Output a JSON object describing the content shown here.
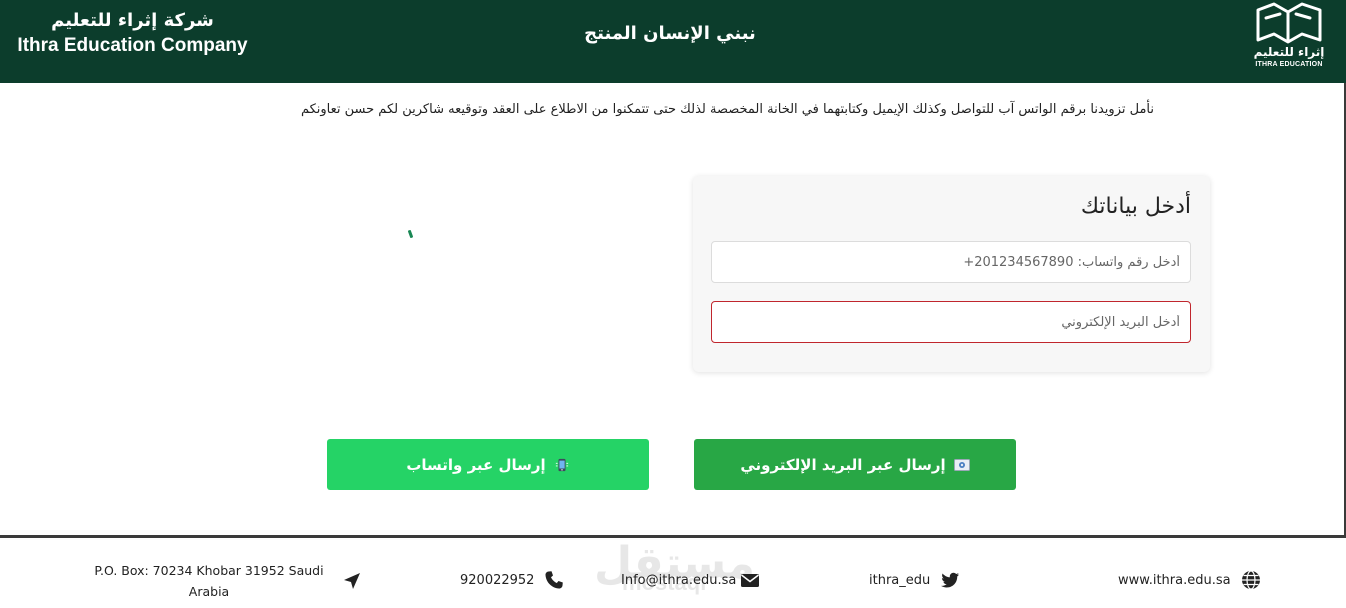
{
  "header": {
    "company_ar": "شركة إثراء للتعليم",
    "company_en": "Ithra Education Company",
    "title": "نبني الإنسان المنتج",
    "logo_ar": "إثراء للتعليم",
    "logo_en": "ITHRA EDUCATION"
  },
  "intro": "نأمل تزويدنا برقم الواتس آب للتواصل وكذلك الإيميل وكتابتهما في الخانة المخصصة لذلك حتى تتمكنوا من الاطلاع على العقد وتوقيعه شاكرين لكم حسن تعاونكم",
  "form": {
    "title": "أدخل بياناتك",
    "phone_placeholder": "أدخل رقم واتساب: 201234567890+",
    "email_placeholder": "أدخل البريد الإلكتروني"
  },
  "buttons": {
    "email_label": "إرسال عبر البريد الإلكتروني",
    "whatsapp_label": "إرسال عبر واتساب",
    "email_icon": "email-icon",
    "whatsapp_icon": "mobile-phone-icon"
  },
  "footer": {
    "website": "www.ithra.edu.sa",
    "twitter": "ithra_edu",
    "email": "Info@ithra.edu.sa",
    "phone": "920022952",
    "address": "P.O. Box: 70234 Khobar 31952 Saudi Arabia",
    "watermark_ar": "مستقل",
    "watermark_en": "mostaql"
  },
  "colors": {
    "header_bg": "#0c3d2c",
    "whatsapp_button": "#25d366",
    "email_button": "#28a745",
    "invalid_border": "#c0262d"
  }
}
